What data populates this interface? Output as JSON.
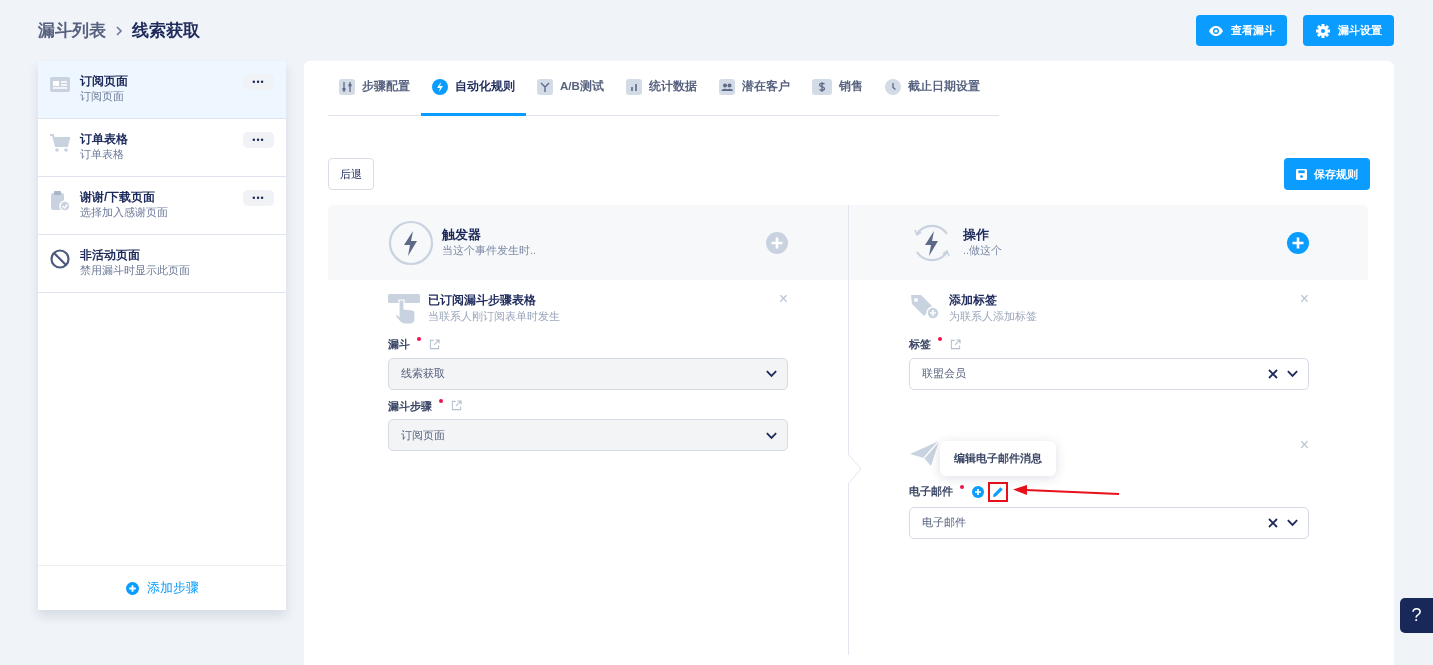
{
  "breadcrumb": [
    {
      "label": "漏斗列表",
      "current": false
    },
    {
      "label": "线索获取",
      "current": true
    }
  ],
  "header_buttons": [
    {
      "kind": "view",
      "label": "查看漏斗"
    },
    {
      "kind": "settings",
      "label": "漏斗设置"
    }
  ],
  "steps": [
    {
      "kind": "page",
      "title": "订阅页面",
      "subtitle": "订阅页面",
      "selected": true,
      "menu": "•••"
    },
    {
      "kind": "cart",
      "title": "订单表格",
      "subtitle": "订单表格",
      "selected": false,
      "menu": "•••"
    },
    {
      "kind": "thanks",
      "title": "谢谢/下载页面",
      "subtitle": "选择加入感谢页面",
      "selected": false,
      "menu": "•••"
    },
    {
      "kind": "inactive",
      "title": "非活动页面",
      "subtitle": "禁用漏斗时显示此页面",
      "selected": false
    }
  ],
  "add_step": "添加步骤",
  "tabs": [
    {
      "kind": "sliders",
      "label": "步骤配置",
      "selected": false
    },
    {
      "kind": "bolt",
      "label": "自动化规则",
      "selected": true
    },
    {
      "kind": "split",
      "label": "A/B测试",
      "selected": false
    },
    {
      "kind": "stats",
      "label": "统计数据",
      "selected": false
    },
    {
      "kind": "people",
      "label": "潜在客户",
      "selected": false
    },
    {
      "kind": "dollar",
      "label": "销售",
      "selected": false
    },
    {
      "kind": "clock",
      "label": "截止日期设置",
      "selected": false
    }
  ],
  "back_button": "后退",
  "save_button": "保存规则",
  "trigger": {
    "kind": "trigger",
    "title": "触发器",
    "subtitle": "当这个事件发生时..",
    "add_enabled": false,
    "cards": [
      {
        "kind": "form",
        "title": "已订阅漏斗步骤表格",
        "subtitle": "当联系人刚订阅表单时发生",
        "close": "×",
        "fields": [
          {
            "label": "漏斗",
            "required": true,
            "link": true,
            "value": "线索获取",
            "disabled": true,
            "clearable": false
          },
          {
            "label": "漏斗步骤",
            "required": true,
            "link": true,
            "value": "订阅页面",
            "disabled": true,
            "clearable": false
          }
        ]
      }
    ]
  },
  "action": {
    "kind": "action",
    "title": "操作",
    "subtitle": "..做这个",
    "add_enabled": true,
    "cards": [
      {
        "kind": "tag",
        "title": "添加标签",
        "subtitle": "为联系人添加标签",
        "close": "×",
        "fields": [
          {
            "label": "标签",
            "required": true,
            "link": true,
            "value": "联盟会员",
            "disabled": false,
            "clearable": true
          }
        ]
      },
      {
        "kind": "email",
        "close": "×",
        "tooltip": "编辑电子邮件消息",
        "fields": [
          {
            "label": "电子邮件",
            "required": true,
            "add": true,
            "edit": true,
            "value": "电子邮件",
            "disabled": false,
            "clearable": true
          }
        ]
      }
    ]
  },
  "help_button": "?"
}
